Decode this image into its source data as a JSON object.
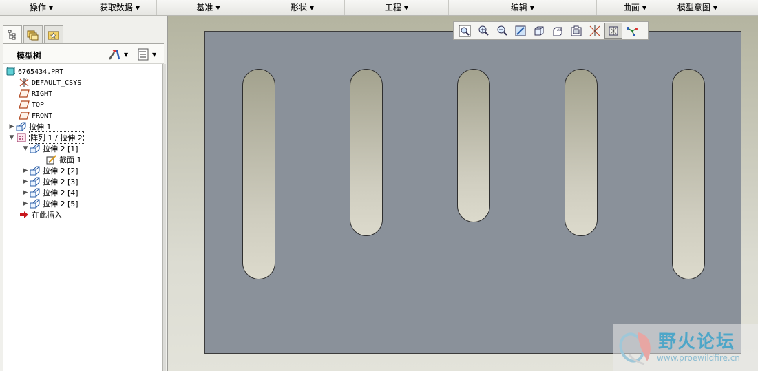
{
  "menubar": {
    "items": [
      {
        "label": "操作"
      },
      {
        "label": "获取数据"
      },
      {
        "label": "基准"
      },
      {
        "label": "形状"
      },
      {
        "label": "工程"
      },
      {
        "label": "编辑"
      },
      {
        "label": "曲面"
      },
      {
        "label": "模型意图"
      }
    ]
  },
  "navigator": {
    "tabs": [
      {
        "icon": "model-tree-icon",
        "active": true
      },
      {
        "icon": "folder-browser-icon",
        "active": false
      },
      {
        "icon": "favorites-icon",
        "active": false
      }
    ],
    "title": "模型树"
  },
  "tree": {
    "nodes": [
      {
        "label": "6765434.PRT",
        "icon": "part-icon",
        "expander": ""
      },
      {
        "label": "DEFAULT_CSYS",
        "icon": "csys-icon",
        "expander": ""
      },
      {
        "label": "RIGHT",
        "icon": "datum-plane-icon",
        "expander": ""
      },
      {
        "label": "TOP",
        "icon": "datum-plane-icon",
        "expander": ""
      },
      {
        "label": "FRONT",
        "icon": "datum-plane-icon",
        "expander": ""
      },
      {
        "label": "拉伸 1",
        "icon": "extrude-icon",
        "expander": "▶"
      },
      {
        "label": "阵列 1 / 拉伸 2",
        "icon": "pattern-icon",
        "expander": "▼"
      },
      {
        "label": "拉伸 2 [1]",
        "icon": "extrude-icon",
        "expander": "▼"
      },
      {
        "label": "截面 1",
        "icon": "sketch-icon",
        "expander": ""
      },
      {
        "label": "拉伸 2 [2]",
        "icon": "extrude-icon",
        "expander": "▶"
      },
      {
        "label": "拉伸 2 [3]",
        "icon": "extrude-icon",
        "expander": "▶"
      },
      {
        "label": "拉伸 2 [4]",
        "icon": "extrude-icon",
        "expander": "▶"
      },
      {
        "label": "拉伸 2 [5]",
        "icon": "extrude-icon",
        "expander": "▶"
      },
      {
        "label": "在此插入",
        "icon": "insert-here-arrow-icon",
        "expander": ""
      }
    ]
  },
  "view_toolbar": {
    "buttons": [
      "zoom-fit-icon",
      "zoom-in-icon",
      "zoom-out-icon",
      "repaint-icon",
      "display-style-icon",
      "saved-views-icon",
      "view-manager-icon",
      "datum-display-icon",
      "spin-center-icon",
      "annotation-display-icon"
    ],
    "active_button": "spin-center-icon"
  },
  "watermark": {
    "title": "野火论坛",
    "url": "www.proewildfire.cn"
  },
  "colors": {
    "part_face": "#8a919a",
    "slot_face": "#c8c6b6",
    "background_top": "#b4b4a0",
    "watermark_blue": "#4ea6c8"
  }
}
